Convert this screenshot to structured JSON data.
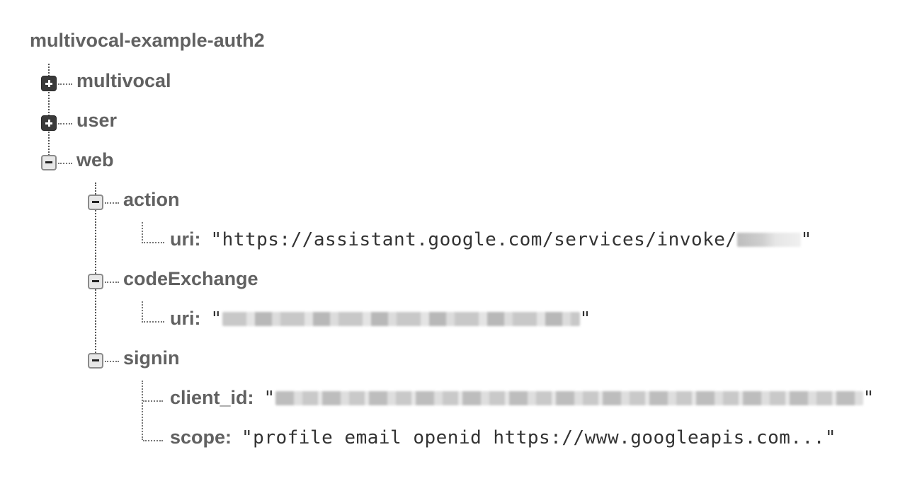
{
  "root": {
    "title": "multivocal-example-auth2"
  },
  "tree": {
    "multivocal": {
      "label": "multivocal",
      "state": "collapsed"
    },
    "user": {
      "label": "user",
      "state": "collapsed"
    },
    "web": {
      "label": "web",
      "state": "expanded",
      "action": {
        "label": "action",
        "state": "expanded",
        "uri": {
          "key": "uri:",
          "value_prefix": "\"https://assistant.google.com/services/invoke/",
          "value_suffix": "\""
        }
      },
      "codeExchange": {
        "label": "codeExchange",
        "state": "expanded",
        "uri": {
          "key": "uri:",
          "value_prefix": "\"",
          "value_suffix": "\""
        }
      },
      "signin": {
        "label": "signin",
        "state": "expanded",
        "client_id": {
          "key": "client_id:",
          "value_prefix": "\"",
          "value_suffix": "\""
        },
        "scope": {
          "key": "scope:",
          "value": "\"profile email openid https://www.googleapis.com...\""
        }
      }
    }
  },
  "colors": {
    "label": "#616161",
    "value": "#333333",
    "redacted": "#d4d4d4"
  },
  "icons": {
    "expand": "plus-box-icon",
    "collapse": "minus-box-icon"
  }
}
